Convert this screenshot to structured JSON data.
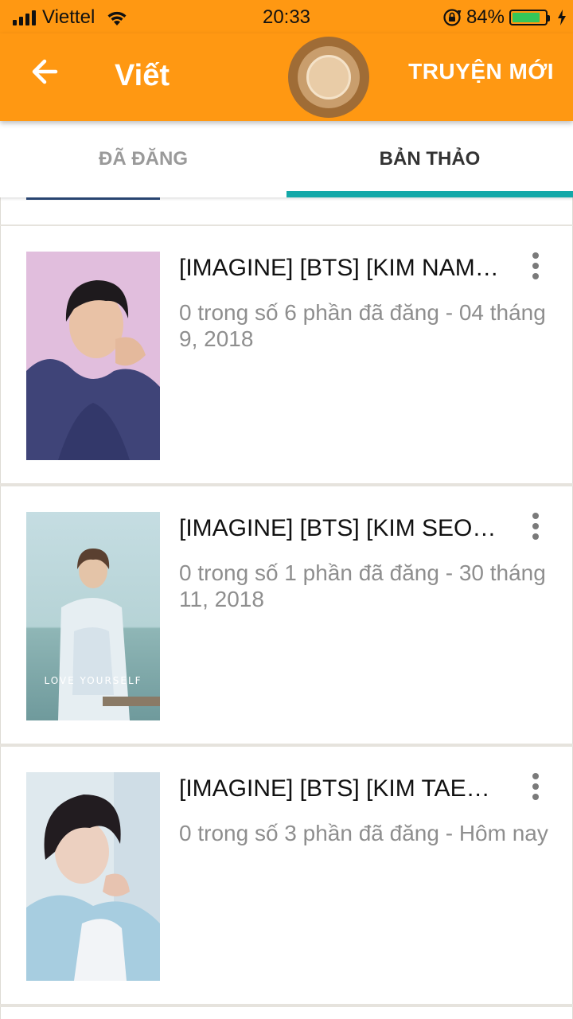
{
  "status_bar": {
    "carrier": "Viettel",
    "time": "20:33",
    "battery_percent": "84%",
    "battery_level": 0.84,
    "icons": [
      "signal-icon",
      "wifi-icon",
      "rotation-lock-icon",
      "battery-icon",
      "charging-icon"
    ]
  },
  "app_bar": {
    "title": "Viết",
    "action": "TRUYỆN MỚI",
    "back_icon": "arrow-left-icon",
    "color": "#ff9812"
  },
  "tabs": [
    {
      "label": "ĐÃ ĐĂNG",
      "active": false
    },
    {
      "label": "BẢN THẢO",
      "active": true
    }
  ],
  "accent_color": "#13a8a8",
  "stories": [
    {
      "title": "[IMAGINE] [BTS] [KIM NAM…",
      "meta": "0 trong số 6 phần đã đăng - 04 tháng 9, 2018",
      "cover_icon": "book-cover-image"
    },
    {
      "title": "[IMAGINE] [BTS] [KIM SEO…",
      "meta": "0 trong số 1 phần đã đăng - 30 tháng 11, 2018",
      "cover_icon": "book-cover-image",
      "cover_text": "LOVE YOURSELF"
    },
    {
      "title": "[IMAGINE] [BTS] [KIM TAEH…",
      "meta": "0 trong số 3 phần đã đăng - Hôm nay",
      "cover_icon": "book-cover-image"
    }
  ]
}
